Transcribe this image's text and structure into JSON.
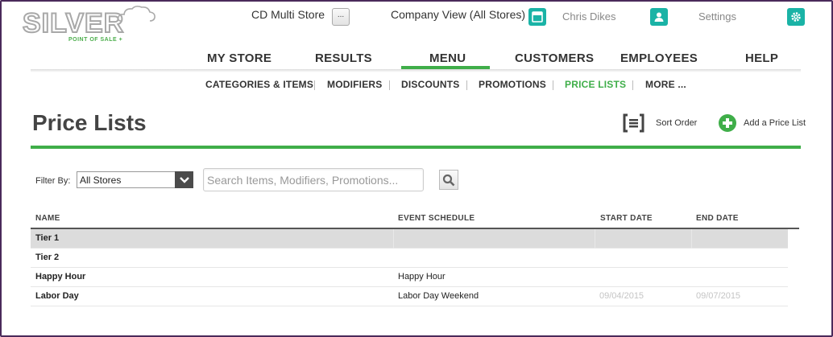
{
  "brand": {
    "logo_word": "SILVER",
    "logo_tag": "POINT OF SALE +"
  },
  "header": {
    "store_name": "CD Multi Store",
    "store_button": "...",
    "company_view": "Company View (All Stores)",
    "user_name": "Chris Dikes",
    "settings_label": "Settings"
  },
  "main_nav": [
    "MY STORE",
    "RESULTS",
    "MENU",
    "CUSTOMERS",
    "EMPLOYEES",
    "HELP"
  ],
  "main_nav_active": "MENU",
  "sub_nav": [
    "CATEGORIES & ITEMS",
    "MODIFIERS",
    "DISCOUNTS",
    "PROMOTIONS",
    "PRICE LISTS",
    "MORE ..."
  ],
  "sub_nav_active": "PRICE LISTS",
  "page": {
    "title": "Price Lists",
    "sort_order_label": "Sort Order",
    "add_label": "Add a Price List"
  },
  "filter": {
    "label": "Filter By:",
    "selected": "All Stores",
    "search_placeholder": "Search Items, Modifiers, Promotions..."
  },
  "table": {
    "columns": [
      "NAME",
      "EVENT SCHEDULE",
      "START DATE",
      "END DATE"
    ],
    "rows": [
      {
        "name": "Tier 1",
        "schedule": "",
        "start": "",
        "end": ""
      },
      {
        "name": "Tier 2",
        "schedule": "",
        "start": "",
        "end": ""
      },
      {
        "name": "Happy Hour",
        "schedule": "Happy Hour",
        "start": "",
        "end": ""
      },
      {
        "name": "Labor Day",
        "schedule": "Labor Day Weekend",
        "start": "09/04/2015",
        "end": "09/07/2015"
      }
    ]
  },
  "colors": {
    "accent_green": "#3fae49",
    "teal_icon": "#1ab3a6",
    "selected_row": "#dcdcdc"
  },
  "icons": [
    "cloud-icon",
    "store-icon",
    "user-icon",
    "gear-icon",
    "sort-order-icon",
    "add-icon",
    "chevron-down-icon",
    "search-icon"
  ]
}
